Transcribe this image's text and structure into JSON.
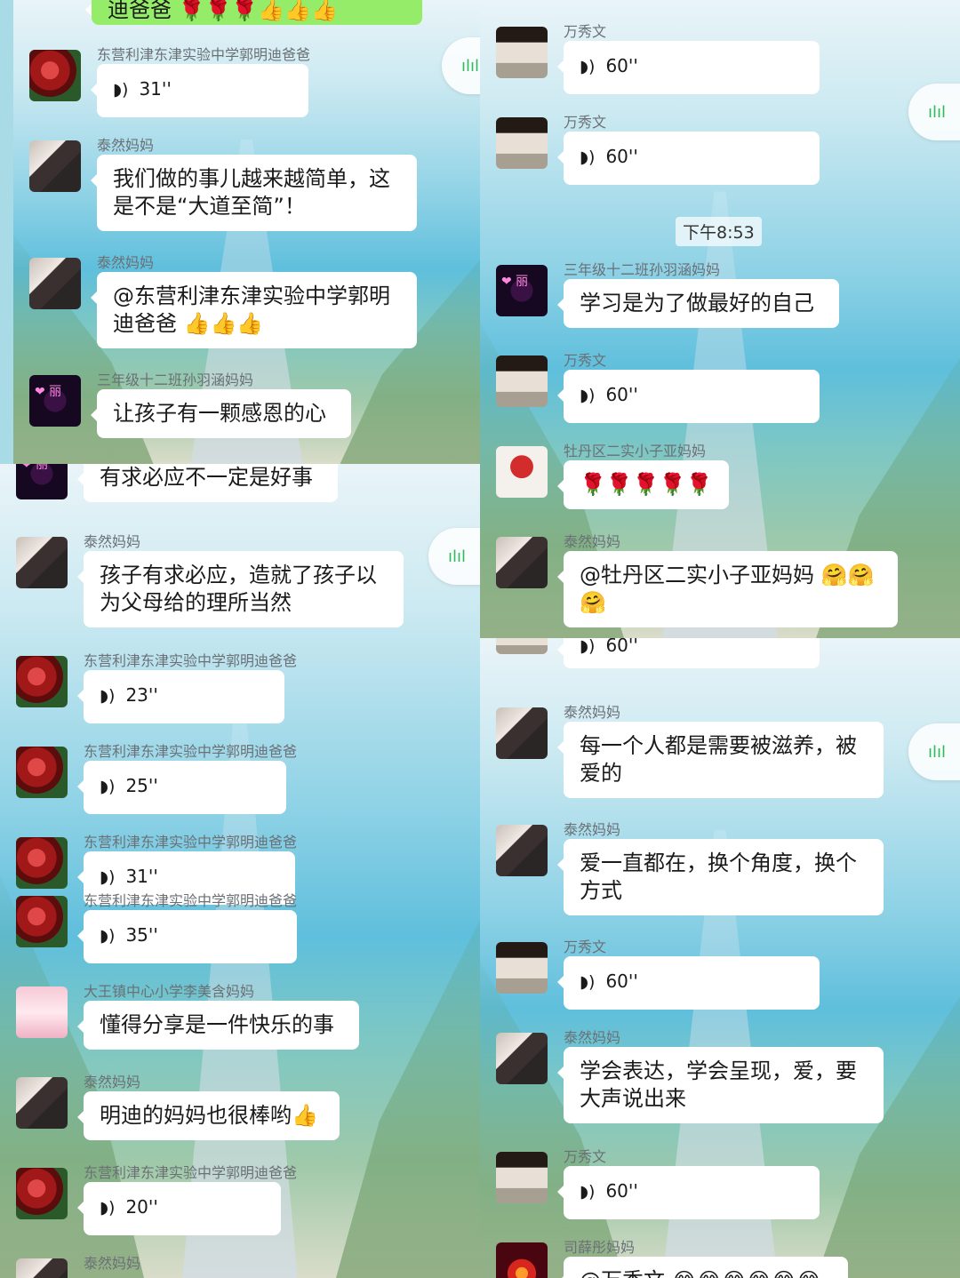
{
  "panels": {
    "tl": {
      "top_bubble": "迪爸爸 🌹🌹🌹👍👍👍",
      "messages": [
        {
          "name": "东营利津东津实验中学郭明迪爸爸",
          "type": "voice",
          "duration": "31''"
        },
        {
          "name": "泰然妈妈",
          "type": "text",
          "text": "我们做的事儿越来越简单，这是不是“大道至简”！"
        },
        {
          "name": "泰然妈妈",
          "type": "text",
          "text": "@东营利津东津实验中学郭明迪爸爸 👍👍👍"
        },
        {
          "name": "三年级十二班孙羽涵妈妈",
          "type": "text",
          "text": "让孩子有一颗感恩的心"
        }
      ]
    },
    "bl": {
      "messages": [
        {
          "name": "",
          "type": "text",
          "text": "有求必应不一定是好事"
        },
        {
          "name": "泰然妈妈",
          "type": "text",
          "text": "孩子有求必应，造就了孩子以为父母给的理所当然"
        },
        {
          "name": "东营利津东津实验中学郭明迪爸爸",
          "type": "voice",
          "duration": "23''"
        },
        {
          "name": "东营利津东津实验中学郭明迪爸爸",
          "type": "voice",
          "duration": "25''"
        },
        {
          "name": "东营利津东津实验中学郭明迪爸爸",
          "type": "voice",
          "duration": "31''"
        },
        {
          "name": "东营利津东津实验中学郭明迪爸爸",
          "type": "voice",
          "duration": "35''"
        },
        {
          "name": "大王镇中心小学李美含妈妈",
          "type": "text",
          "text": "懂得分享是一件快乐的事"
        },
        {
          "name": "泰然妈妈",
          "type": "text",
          "text": "明迪的妈妈也很棒哟👍"
        },
        {
          "name": "东营利津东津实验中学郭明迪爸爸",
          "type": "voice",
          "duration": "20''"
        },
        {
          "name": "泰然妈妈",
          "type": "text",
          "text": ""
        }
      ]
    },
    "tr": {
      "time": "下午8:53",
      "messages": [
        {
          "name": "万秀文",
          "type": "voice",
          "duration": "60''"
        },
        {
          "name": "万秀文",
          "type": "voice",
          "duration": "60''"
        },
        {
          "name": "三年级十二班孙羽涵妈妈",
          "type": "text",
          "text": "学习是为了做最好的自己"
        },
        {
          "name": "万秀文",
          "type": "voice",
          "duration": "60''"
        },
        {
          "name": "牡丹区二实小子亚妈妈",
          "type": "text",
          "text": "🌹🌹🌹🌹🌹"
        },
        {
          "name": "泰然妈妈",
          "type": "text",
          "text": "@牡丹区二实小子亚妈妈 🤗🤗🤗"
        }
      ]
    },
    "br": {
      "messages": [
        {
          "name": "",
          "type": "voice",
          "duration": "60''"
        },
        {
          "name": "泰然妈妈",
          "type": "text",
          "text": "每一个人都是需要被滋养，被爱的"
        },
        {
          "name": "泰然妈妈",
          "type": "text",
          "text": "爱一直都在，换个角度，换个方式"
        },
        {
          "name": "万秀文",
          "type": "voice",
          "duration": "60''"
        },
        {
          "name": "泰然妈妈",
          "type": "text",
          "text": "学会表达，学会呈现，爱，要大声说出来"
        },
        {
          "name": "万秀文",
          "type": "voice",
          "duration": "60''"
        },
        {
          "name": "司薛彤妈妈",
          "type": "text",
          "text": "@万秀文 😂😂😂😂😂😂"
        }
      ]
    }
  },
  "icons": {
    "voice": "voice-wave-icon",
    "side": "audio-bars-icon"
  },
  "colors": {
    "bubble": "#ffffff",
    "self_bubble": "#95ec69",
    "accent": "#2fb95a"
  }
}
